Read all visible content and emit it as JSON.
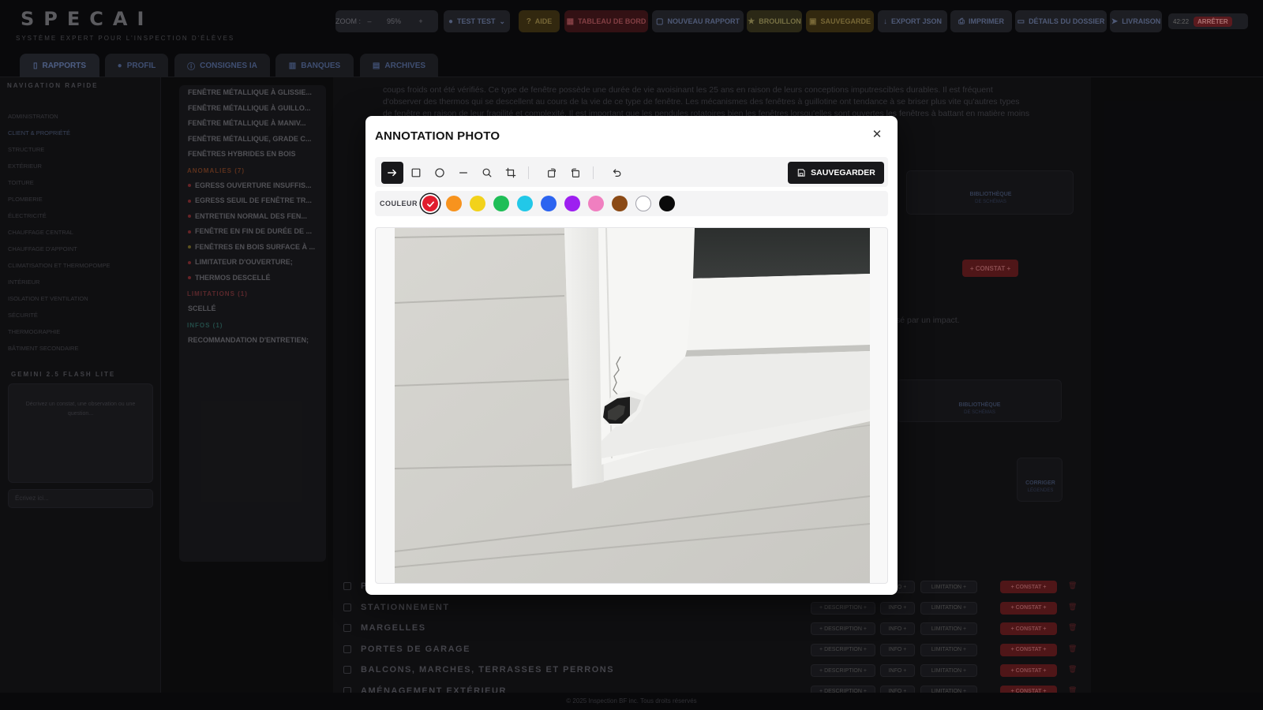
{
  "app": {
    "logo": "SPECAI",
    "subtitle": "SYSTÈME EXPERT POUR L'INSPECTION D'ÉLÈVES",
    "footer": "© 2025 Inspection BF inc. Tous droits réservés"
  },
  "toolbar": {
    "zoom_label": "ZOOM :",
    "zoom_minus": "–",
    "zoom_value": "95%",
    "zoom_plus": "+",
    "client": "TEST TEST",
    "help": "AIDE",
    "dashboard": "TABLEAU DE BORD",
    "new_report": "NOUVEAU RAPPORT",
    "draft": "BROUILLON",
    "save": "SAUVEGARDE",
    "export": "EXPORT JSON",
    "print": "IMPRIMER",
    "folder_details": "DÉTAILS DU DOSSIER",
    "delivery": "LIVRAISON",
    "timer": "42:22",
    "stop": "ARRÊTER"
  },
  "tabs": [
    {
      "label": "RAPPORTS"
    },
    {
      "label": "PROFIL"
    },
    {
      "label": "CONSIGNES IA"
    },
    {
      "label": "BANQUES"
    },
    {
      "label": "ARCHIVES"
    }
  ],
  "nav": {
    "title": "NAVIGATION RAPIDE",
    "items": [
      "ADMINISTRATION",
      "CLIENT & PROPRIÉTÉ",
      "STRUCTURE",
      "EXTÉRIEUR",
      "TOITURE",
      "PLOMBERIE",
      "ÉLECTRICITÉ",
      "CHAUFFAGE CENTRAL",
      "CHAUFFAGE D'APPOINT",
      "CLIMATISATION ET THERMOPOMPE",
      "INTÉRIEUR",
      "ISOLATION ET VENTILATION",
      "SÉCURITÉ",
      "THERMOGRAPHIE",
      "BÂTIMENT SECONDAIRE"
    ],
    "gemini_title": "GEMINI 2.5 FLASH LITE",
    "gemini_placeholder": "Décrivez un constat, une observation ou une question...",
    "gemini_input": "Écrivez ici..."
  },
  "list": {
    "items_top": [
      "FENÊTRE MÉTALLIQUE À GLISSIE...",
      "FENÊTRE MÉTALLIQUE À GUILLO...",
      "FENÊTRE MÉTALLIQUE À MANIV...",
      "FENÊTRE MÉTALLIQUE, GRADE C...",
      "FENÊTRES HYBRIDES EN BOIS"
    ],
    "anomalies_title": "ANOMALIES (7)",
    "anomalies": [
      "EGRESS OUVERTURE INSUFFIS...",
      "EGRESS SEUIL DE FENÊTRE TR...",
      "ENTRETIEN NORMAL DES FEN...",
      "FENÊTRE EN FIN DE DURÉE DE ...",
      "FENÊTRES EN BOIS SURFACE À ...",
      "LIMITATEUR D'OUVERTURE;",
      "THERMOS DESCELLÉ"
    ],
    "limitations_title": "LIMITATIONS (1)",
    "limitations": [
      "SCELLÉ"
    ],
    "infos_title": "INFOS (1)",
    "infos": [
      "RECOMMANDATION D'ENTRETIEN;"
    ]
  },
  "background": {
    "paragraph": "coups froids ont été vérifiés. Ce type de fenêtre possède une durée de vie avoisinant les 25 ans en raison de leurs conceptions imputrescibles durables. Il est fréquent d'observer des thermos qui se descellent au cours de la vie de ce type de fenêtre. Les mécanismes des fenêtres à guillotine ont tendance à se briser plus vite qu'autres types de fenêtre en raison de leur fragilité et complexité. Il est important que les pendules rotatoires bien les fenêtres lorsqu'elles sont ouvertes les fenêtres à battant en matière moins étanches à la base et le",
    "impact_text": "sé par un impact.",
    "library_label": "BIBLIOTHÈQUE",
    "library_sub": "DE SCHÉMAS",
    "correct_label": "CORRIGER",
    "correct_sub": "LÉGENDES",
    "constat": "+ CONSTAT +",
    "rows": [
      "P",
      "STATIONNEMENT",
      "MARGELLES",
      "PORTES DE GARAGE",
      "BALCONS, MARCHES, TERRASSES ET PERRONS",
      "AMÉNAGEMENT EXTÉRIEUR"
    ],
    "row_description": "+ DESCRIPTION +",
    "row_info": "INFO +",
    "row_limitation": "LIMITATION +",
    "row_constat": "+ CONSTAT +"
  },
  "modal": {
    "title": "ANNOTATION PHOTO",
    "save_label": "SAUVEGARDER",
    "color_label": "COULEUR",
    "tools": [
      "arrow-tool",
      "rectangle-tool",
      "circle-tool",
      "line-tool",
      "zoom-tool",
      "crop-tool",
      "rotate-left-tool",
      "rotate-right-tool",
      "undo-tool"
    ],
    "active_tool": "arrow-tool",
    "selected_color": "#e11d2e",
    "colors": [
      "#e11d2e",
      "#f7931e",
      "#f2d21b",
      "#1fbe57",
      "#22c8e8",
      "#2c64f0",
      "#9d1ff0",
      "#f07fc0",
      "#8b4a16",
      "#ffffff",
      "#0a0a0a"
    ]
  }
}
